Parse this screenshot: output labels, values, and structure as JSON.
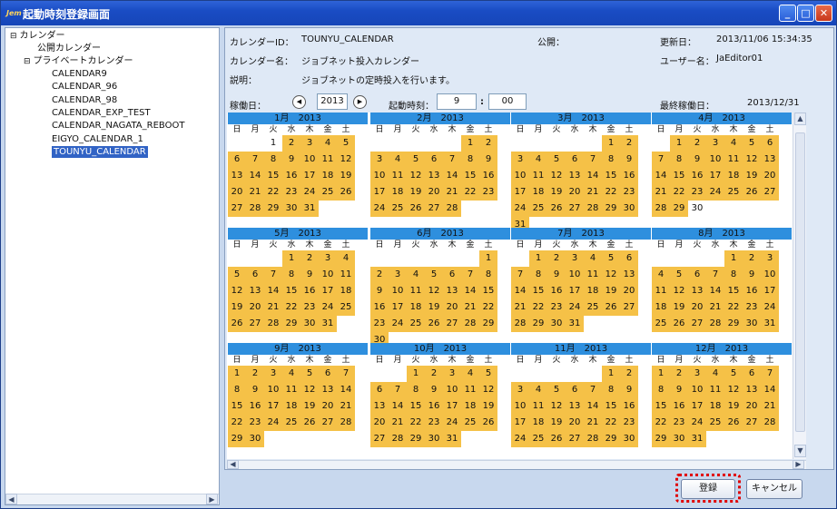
{
  "window": {
    "app_icon": "Jem",
    "title": "起動時刻登録画面",
    "min_label": "_",
    "max_label": "□",
    "close_label": "✕"
  },
  "tree": {
    "root": "カレンダー",
    "root_toggle": "⊟",
    "public": "公開カレンダー",
    "private": "プライベートカレンダー",
    "private_toggle": "⊟",
    "items": [
      "CALENDAR9",
      "CALENDAR_96",
      "CALENDAR_98",
      "CALENDAR_EXP_TEST",
      "CALENDAR_NAGATA_REBOOT",
      "EIGYO_CALENDAR_1",
      "TOUNYU_CALENDAR"
    ],
    "selected_index": 6
  },
  "info": {
    "calendar_id_label": "カレンダーID：",
    "calendar_id": "TOUNYU_CALENDAR",
    "public_label": "公開：",
    "public_value": "",
    "updated_label": "更新日：",
    "updated": "2013/11/06 15:34:35",
    "calendar_name_label": "カレンダー名：",
    "calendar_name": "ジョブネット投入カレンダー",
    "user_label": "ユーザー名：",
    "user": "JaEditor01",
    "desc_label": "説明：",
    "desc": "ジョブネットの定時投入を行います。"
  },
  "controls": {
    "operating_day_label": "稼働日：",
    "year": "2013",
    "prev_icon": "◀",
    "next_icon": "▶",
    "start_time_label": "起動時刻：",
    "hour": "9",
    "colon": ":",
    "minute": "00",
    "last_day_label": "最終稼働日：",
    "last_day": "2013/12/31"
  },
  "weekdays": [
    "日",
    "月",
    "火",
    "水",
    "木",
    "金",
    "土"
  ],
  "colors": {
    "operating": "#f5c147",
    "header": "#2e8fde"
  },
  "months": [
    {
      "label": "1月　2013",
      "start": 2,
      "days": 31,
      "off": [
        1
      ]
    },
    {
      "label": "2月　2013",
      "start": 5,
      "days": 28,
      "off": []
    },
    {
      "label": "3月　2013",
      "start": 5,
      "days": 31,
      "off": []
    },
    {
      "label": "4月　2013",
      "start": 1,
      "days": 30,
      "off": [
        30
      ]
    },
    {
      "label": "5月　2013",
      "start": 3,
      "days": 31,
      "off": []
    },
    {
      "label": "6月　2013",
      "start": 6,
      "days": 30,
      "off": []
    },
    {
      "label": "7月　2013",
      "start": 1,
      "days": 31,
      "off": []
    },
    {
      "label": "8月　2013",
      "start": 4,
      "days": 31,
      "off": []
    },
    {
      "label": "9月　2013",
      "start": 0,
      "days": 30,
      "off": []
    },
    {
      "label": "10月　2013",
      "start": 2,
      "days": 31,
      "off": []
    },
    {
      "label": "11月　2013",
      "start": 5,
      "days": 30,
      "off": []
    },
    {
      "label": "12月　2013",
      "start": 0,
      "days": 31,
      "off": []
    }
  ],
  "buttons": {
    "register": "登録",
    "cancel": "キャンセル"
  },
  "scroll": {
    "up_icon": "▲",
    "down_icon": "▼",
    "left_icon": "◀",
    "right_icon": "▶"
  }
}
